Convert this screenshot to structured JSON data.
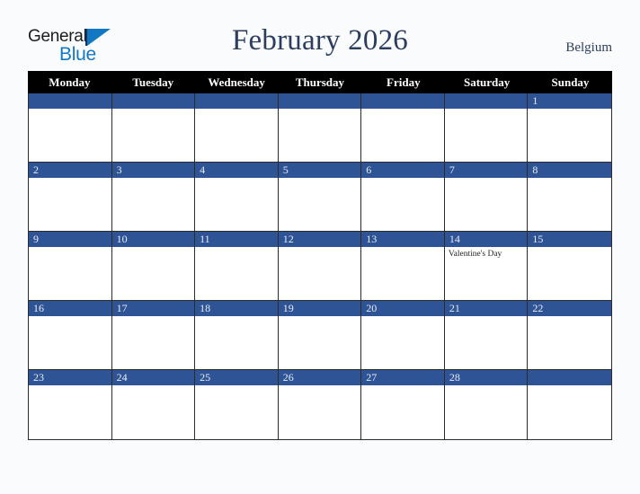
{
  "brand": {
    "name_part1": "General",
    "name_part2": "Blue",
    "logo_icon": "triangle-icon"
  },
  "header": {
    "title": "February 2026",
    "region": "Belgium"
  },
  "colors": {
    "accent_blue": "#2f5496",
    "logo_blue": "#1378c4",
    "title_navy": "#2c3e60",
    "header_bar": "#000000",
    "page_background": "#fafbfc",
    "cell_background": "#ffffff",
    "grid_line": "#2b2b2b"
  },
  "calendar": {
    "month": "February",
    "year": "2026",
    "day_headers": [
      "Monday",
      "Tuesday",
      "Wednesday",
      "Thursday",
      "Friday",
      "Saturday",
      "Sunday"
    ],
    "weeks": [
      [
        {
          "num": "",
          "events": []
        },
        {
          "num": "",
          "events": []
        },
        {
          "num": "",
          "events": []
        },
        {
          "num": "",
          "events": []
        },
        {
          "num": "",
          "events": []
        },
        {
          "num": "",
          "events": []
        },
        {
          "num": "1",
          "events": []
        }
      ],
      [
        {
          "num": "2",
          "events": []
        },
        {
          "num": "3",
          "events": []
        },
        {
          "num": "4",
          "events": []
        },
        {
          "num": "5",
          "events": []
        },
        {
          "num": "6",
          "events": []
        },
        {
          "num": "7",
          "events": []
        },
        {
          "num": "8",
          "events": []
        }
      ],
      [
        {
          "num": "9",
          "events": []
        },
        {
          "num": "10",
          "events": []
        },
        {
          "num": "11",
          "events": []
        },
        {
          "num": "12",
          "events": []
        },
        {
          "num": "13",
          "events": []
        },
        {
          "num": "14",
          "events": [
            "Valentine's Day"
          ]
        },
        {
          "num": "15",
          "events": []
        }
      ],
      [
        {
          "num": "16",
          "events": []
        },
        {
          "num": "17",
          "events": []
        },
        {
          "num": "18",
          "events": []
        },
        {
          "num": "19",
          "events": []
        },
        {
          "num": "20",
          "events": []
        },
        {
          "num": "21",
          "events": []
        },
        {
          "num": "22",
          "events": []
        }
      ],
      [
        {
          "num": "23",
          "events": []
        },
        {
          "num": "24",
          "events": []
        },
        {
          "num": "25",
          "events": []
        },
        {
          "num": "26",
          "events": []
        },
        {
          "num": "27",
          "events": []
        },
        {
          "num": "28",
          "events": []
        },
        {
          "num": "",
          "events": []
        }
      ]
    ]
  }
}
